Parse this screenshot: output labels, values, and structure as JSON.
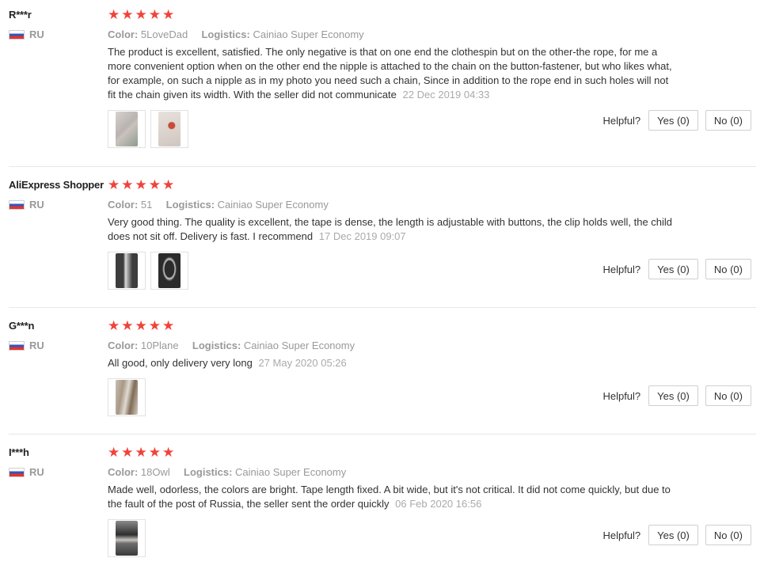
{
  "star_glyph": "★",
  "helpful_label": "Helpful?",
  "color_label": "Color:",
  "logistics_label": "Logistics:",
  "star_color": "#f0433a",
  "reviews": [
    {
      "user": "R***r",
      "country": "RU",
      "rating": 5,
      "color": "5LoveDad",
      "logistics": "Cainiao Super Economy",
      "text": "The product is excellent, satisfied. The only negative is that on one end the clothespin but on the other-the rope, for me a more convenient option when on the other end the nipple is attached to the chain on the button-fastener, but who likes what, for example, on such a nipple as in my photo you need such a chain, Since in addition to the rope end in such holes will not fit the chain given its width. With the seller did not communicate",
      "date": "22 Dec 2019 04:33",
      "photos": 2,
      "yes": "Yes (0)",
      "no": "No (0)"
    },
    {
      "user": "AliExpress Shopper",
      "country": "RU",
      "rating": 5,
      "color": "51",
      "logistics": "Cainiao Super Economy",
      "text": "Very good thing. The quality is excellent, the tape is dense, the length is adjustable with buttons, the clip holds well, the child does not sit off. Delivery is fast. I recommend",
      "date": "17 Dec 2019 09:07",
      "photos": 2,
      "yes": "Yes (0)",
      "no": "No (0)"
    },
    {
      "user": "G***n",
      "country": "RU",
      "rating": 5,
      "color": "10Plane",
      "logistics": "Cainiao Super Economy",
      "text": "All good, only delivery very long",
      "date": "27 May 2020 05:26",
      "photos": 1,
      "yes": "Yes (0)",
      "no": "No (0)"
    },
    {
      "user": "I***h",
      "country": "RU",
      "rating": 5,
      "color": "18Owl",
      "logistics": "Cainiao Super Economy",
      "text": "Made well, odorless, the colors are bright. Tape length fixed. A bit wide, but it's not critical. It did not come quickly, but due to the fault of the post of Russia, the seller sent the order quickly",
      "date": "06 Feb 2020 16:56",
      "photos": 1,
      "yes": "Yes (0)",
      "no": "No (0)"
    }
  ]
}
